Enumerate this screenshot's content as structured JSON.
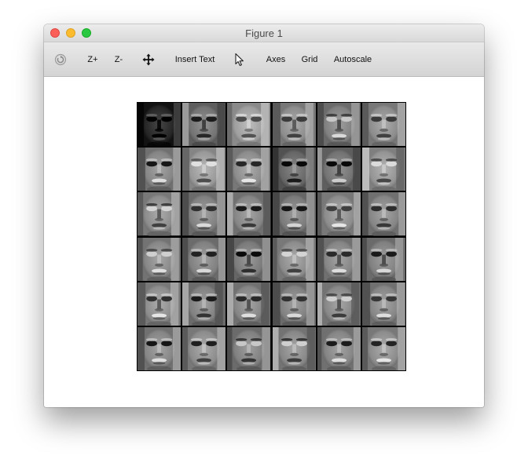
{
  "window": {
    "title": "Figure 1"
  },
  "toolbar": {
    "items": [
      {
        "id": "rotate",
        "label": "",
        "icon": "rotate-icon",
        "interactable": true
      },
      {
        "id": "zoom-in",
        "label": "Z+",
        "interactable": true
      },
      {
        "id": "zoom-out",
        "label": "Z-",
        "interactable": true
      },
      {
        "id": "pan",
        "label": "",
        "icon": "pan-arrows-icon",
        "interactable": true
      },
      {
        "id": "insert-text",
        "label": "Insert Text",
        "interactable": true
      },
      {
        "id": "select",
        "label": "",
        "icon": "pointer-icon",
        "interactable": true
      },
      {
        "id": "axes",
        "label": "Axes",
        "interactable": true
      },
      {
        "id": "grid",
        "label": "Grid",
        "interactable": true
      },
      {
        "id": "autoscale",
        "label": "Autoscale",
        "interactable": true
      }
    ]
  },
  "figure": {
    "rows": 6,
    "cols": 6,
    "colormap": "gray",
    "tile_shading": [
      [
        0.15,
        0.45,
        0.62,
        0.55,
        0.5,
        0.55
      ],
      [
        0.52,
        0.6,
        0.55,
        0.4,
        0.45,
        0.58
      ],
      [
        0.55,
        0.5,
        0.52,
        0.48,
        0.55,
        0.52
      ],
      [
        0.53,
        0.5,
        0.48,
        0.55,
        0.52,
        0.5
      ],
      [
        0.55,
        0.5,
        0.52,
        0.5,
        0.53,
        0.52
      ],
      [
        0.52,
        0.55,
        0.5,
        0.53,
        0.52,
        0.55
      ]
    ]
  },
  "colors": {
    "close": "#fc5f57",
    "minimize": "#fdbc2e",
    "maximize": "#29c840"
  }
}
